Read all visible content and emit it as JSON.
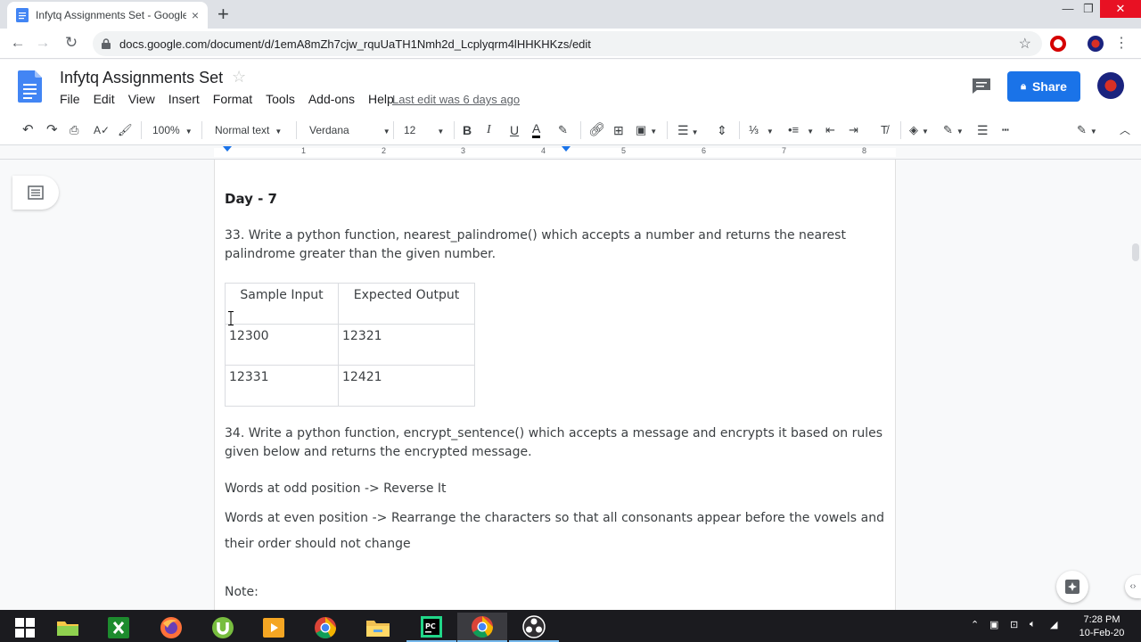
{
  "browser": {
    "tab_title": "Infytq Assignments Set - Google",
    "tab_close": "×",
    "new_tab": "+",
    "url": "docs.google.com/document/d/1emA8mZh7cjw_rquUaTH1Nmh2d_Lcplyqrm4lHHKHKzs/edit",
    "window_controls": {
      "minimize": "—",
      "restore": "❐",
      "close": "✕"
    }
  },
  "docs": {
    "title": "Infytq Assignments Set",
    "star": "☆",
    "menu": [
      "File",
      "Edit",
      "View",
      "Insert",
      "Format",
      "Tools",
      "Add-ons",
      "Help"
    ],
    "last_edit": "Last edit was 6 days ago",
    "share_label": "Share"
  },
  "toolbar": {
    "zoom": "100%",
    "style": "Normal text",
    "font": "Verdana",
    "font_size": "12",
    "bold": "B",
    "italic": "I",
    "underline": "U",
    "text_color": "A"
  },
  "ruler": [
    "1",
    "2",
    "3",
    "4",
    "5",
    "6",
    "7",
    "8"
  ],
  "document": {
    "heading": "Day - 7",
    "q33": "33. Write a python function, nearest_palindrome() which accepts a number and returns the nearest palindrome greater than the given number.",
    "table": {
      "headers": [
        "Sample Input",
        "Expected Output"
      ],
      "rows": [
        [
          "12300",
          "12321"
        ],
        [
          "12331",
          "12421"
        ]
      ]
    },
    "q34": "34. Write a python function, encrypt_sentence() which accepts a message and encrypts it based on rules given below and returns the encrypted message.",
    "rule1": "Words at odd position -> Reverse It",
    "rule2": "Words at even position -> Rearrange the characters so that all consonants appear before the vowels and their order should not change",
    "note": "Note:"
  },
  "taskbar": {
    "time": "7:28 PM",
    "date": "10-Feb-20",
    "apps": [
      "start-button",
      "file-folder",
      "excel",
      "firefox",
      "utorrent",
      "media-player",
      "chrome",
      "file-explorer",
      "pycharm",
      "chrome-active",
      "obs"
    ]
  },
  "colors": {
    "accent": "#1a73e8",
    "taskbar": "#1b1b1f"
  }
}
